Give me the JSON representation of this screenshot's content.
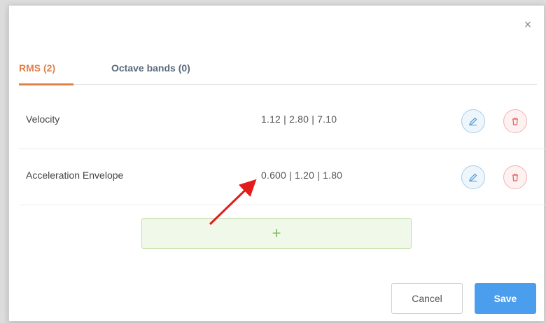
{
  "dialog": {
    "close_icon": "close-icon",
    "tabs": [
      {
        "label": "RMS (2)",
        "active": true
      },
      {
        "label": "Octave bands (0)",
        "active": false
      }
    ],
    "rows": [
      {
        "name": "Velocity",
        "values": "1.12 | 2.80 | 7.10"
      },
      {
        "name": "Acceleration Envelope",
        "values": "0.600 | 1.20 | 1.80"
      }
    ],
    "add_label": "+",
    "cancel_label": "Cancel",
    "save_label": "Save"
  },
  "colors": {
    "accent": "#e0824a",
    "primary": "#4b9eee",
    "edit": "#a9cce8",
    "delete": "#f0b4b4",
    "add": "#7fb65a",
    "annotation_arrow": "#e31c1c"
  }
}
